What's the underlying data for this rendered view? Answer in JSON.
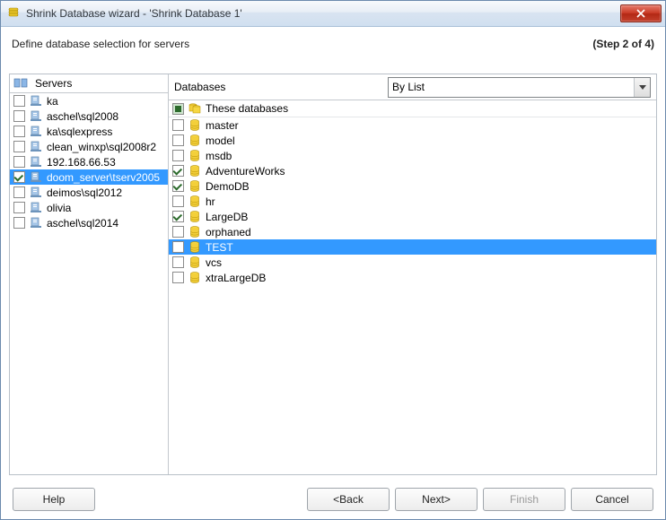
{
  "window": {
    "title": "Shrink Database wizard - 'Shrink Database 1'"
  },
  "subheader": {
    "text": "Define database selection for servers",
    "step": "(Step 2 of 4)"
  },
  "left": {
    "header": "Servers",
    "items": [
      {
        "label": "ka",
        "checked": false
      },
      {
        "label": "aschel\\sql2008",
        "checked": false
      },
      {
        "label": "ka\\sqlexpress",
        "checked": false
      },
      {
        "label": "clean_winxp\\sql2008r2",
        "checked": false
      },
      {
        "label": "192.168.66.53",
        "checked": false
      },
      {
        "label": "doom_server\\tserv2005",
        "checked": true,
        "selected": true
      },
      {
        "label": "deimos\\sql2012",
        "checked": false
      },
      {
        "label": "olivia",
        "checked": false
      },
      {
        "label": "aschel\\sql2014",
        "checked": false
      }
    ]
  },
  "filter": {
    "label": "Databases",
    "value": "By List"
  },
  "dbheader": {
    "label": "These databases"
  },
  "databases": [
    {
      "label": "master",
      "checked": false
    },
    {
      "label": "model",
      "checked": false
    },
    {
      "label": "msdb",
      "checked": false
    },
    {
      "label": "AdventureWorks",
      "checked": true
    },
    {
      "label": "DemoDB",
      "checked": true
    },
    {
      "label": "hr",
      "checked": false
    },
    {
      "label": "LargeDB",
      "checked": true
    },
    {
      "label": "orphaned",
      "checked": false
    },
    {
      "label": "TEST",
      "checked": false,
      "selected": true
    },
    {
      "label": "vcs",
      "checked": false
    },
    {
      "label": "xtraLargeDB",
      "checked": false
    }
  ],
  "buttons": {
    "help": "Help",
    "back": "<Back",
    "next": "Next>",
    "finish": "Finish",
    "cancel": "Cancel"
  }
}
